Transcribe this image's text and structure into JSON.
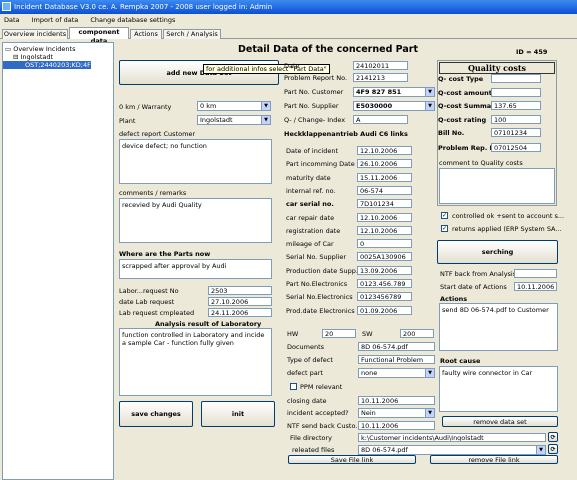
{
  "window": {
    "title": "Incident Database V3.0       ce. A. Rempka 2007 - 2008   user logged in: Admin"
  },
  "menu": [
    "Data",
    "Import of data",
    "Change database settings"
  ],
  "tabs": [
    "Overview incidents",
    "component data",
    "Actions",
    "Serch / Analysis"
  ],
  "tree": {
    "root": "Overview Incidents",
    "plant": "Ingolstadt",
    "item": "OST;2440203;KD;4F9 8..."
  },
  "header": {
    "title": "Detail Data of the concerned Part",
    "id_label": "ID = ",
    "id_value": "459"
  },
  "tooltip": "for additional infos select \"Part Data\"",
  "left": {
    "add_button": "add new Data Set",
    "warranty_label": "0 km / Warranty",
    "warranty_value": "0 km",
    "plant_label": "Plant",
    "plant_value": "Ingolstadt",
    "defect_label": "defect report Customer",
    "defect_text": "device defect; no function",
    "comments_label": "comments / remarks",
    "comments_text": "recevied by Audi Quality",
    "where_label": "Where are the Parts now",
    "where_text": "scrapped after approval by Audi",
    "labor_no_label": "Labor...request No",
    "labor_no_value": "2503",
    "date_lab_label": "date Lab request",
    "date_lab_value": "27.10.2006",
    "lab_done_label": "Lab request cmpleated",
    "lab_done_value": "24.11.2006",
    "analysis_label": "Analysis result of Laboratory",
    "analysis_text": "function controlled in Laboratory and incide a sample Car - function fully given",
    "save_button": "save changes",
    "init_button": "init"
  },
  "center": {
    "fields": [
      {
        "label": "Date",
        "value": "24102011"
      },
      {
        "label": "Problem Report No.",
        "value": "2141213"
      },
      {
        "label": "Part No. Customer",
        "value": "4F9 827 851"
      },
      {
        "label": "Part No. Supplier",
        "value": "E5030000"
      },
      {
        "label": "Q- / Change- Index",
        "value": "A"
      }
    ],
    "part_name": "Heckklappenantrieb Audi C6 links",
    "fields2": [
      {
        "label": "Date of incident",
        "value": "12.10.2006"
      },
      {
        "label": "Part incomming Date",
        "value": "26.10.2006"
      },
      {
        "label": "maturity date",
        "value": "15.11.2006"
      },
      {
        "label": "internal ref. no.",
        "value": "06-574"
      },
      {
        "label": "car serial no.",
        "value": "7D101234"
      },
      {
        "label": "car repair date",
        "value": "12.10.2006"
      },
      {
        "label": "registration date",
        "value": "12.10.2006"
      },
      {
        "label": "mileage of Car",
        "value": "0"
      },
      {
        "label": "Serial No. Supplier",
        "value": "0025A130906"
      },
      {
        "label": "Production date Supp...",
        "value": "13.09.2006"
      },
      {
        "label": "Part No.Electronics",
        "value": "0123.456.789"
      },
      {
        "label": "Serial No.Electronics",
        "value": "0123456789"
      },
      {
        "label": "Prod.date Electronics",
        "value": "01.09.2006"
      }
    ],
    "hw_label": "HW",
    "hw_value": "20",
    "sw_label": "SW",
    "sw_value": "200",
    "documents_label": "Documents",
    "documents_value": "8D 06-574.pdf",
    "type_label": "Type of defect",
    "type_value": "Functional Problem",
    "defect_part_label": "defect part",
    "defect_part_value": "none",
    "ppm_label": "PPM relevant",
    "closing_label": "closing date",
    "closing_value": "10.11.2006",
    "accepted_label": "incident accepted?",
    "accepted_value": "Nein",
    "ntf_label": "NTF send back Custo...",
    "ntf_value": "10.11.2006",
    "file_dir_label": "File directory",
    "file_dir_value": "k:\\Customer incidents\\Audi\\Ingolstadt",
    "related_label": "releated files",
    "related_value": "8D 06-574.pdf",
    "save_file": "Save File link",
    "remove_file": "remove File link"
  },
  "right": {
    "quality_title": "Quality costs",
    "costs": [
      {
        "label": "Q- cost Type",
        "value": ""
      },
      {
        "label": "Q-cost amount",
        "value": ""
      },
      {
        "label": "Q-cost Summary",
        "value": "137.65"
      },
      {
        "label": "Q-cost rating",
        "value": "100"
      },
      {
        "label": "Bill No.",
        "value": "07101234"
      },
      {
        "label": "Problem Rep. No.",
        "value": "07012504"
      }
    ],
    "comment_label": "comment to Quality costs",
    "check1": "controlled ok +sent to account s...",
    "check2": "returns applied (ERP System SA...",
    "search_button": "serching",
    "ntf_back_label": "NTF back from Analysis",
    "start_label": "Start date of Actions",
    "start_value": "10.11.2006",
    "actions_label": "Actions",
    "actions_text": "send 8D 06-574.pdf to Customer",
    "root_label": "Root cause",
    "root_text": "faulty wire connector in Car",
    "remove_button": "remove data set"
  }
}
